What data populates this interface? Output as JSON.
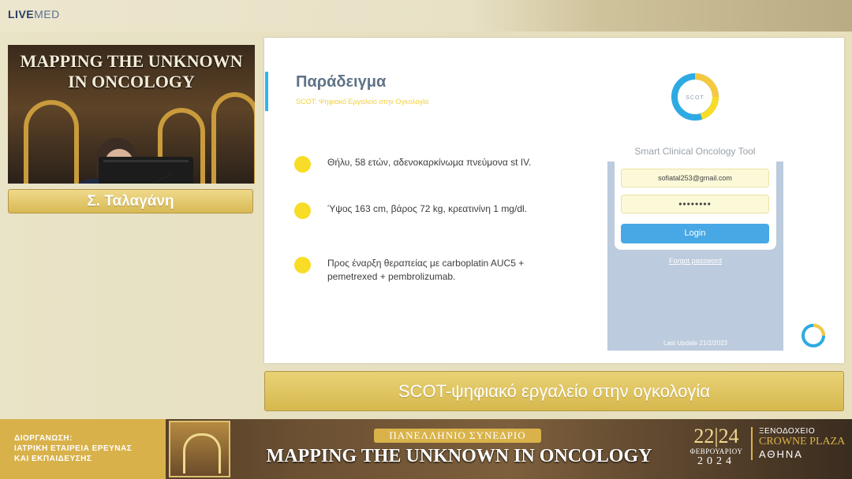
{
  "brand": {
    "live": "LIVE",
    "med": "MED"
  },
  "video": {
    "line1": "MAPPING THE UNKNOWN",
    "line2": "IN ONCOLOGY"
  },
  "speaker": {
    "name": "Σ. Ταλαγάνη"
  },
  "slide": {
    "title": "Παράδειγμα",
    "subtitle": "SCOT: Ψηφιακό Εργαλείο στην Ογκολογία",
    "bullets": [
      {
        "text": "Θήλυ, 58 ετών, αδενοκαρκίνωμα πνεύμονα st IV."
      },
      {
        "text": "Ύψος 163 cm, βάρος 72 kg, κρεατινίνη 1 mg/dl."
      },
      {
        "text": "Προς έναρξη θεραπείας με carboplatin AUC5 + pemetrexed + pembrolizumab."
      }
    ],
    "logo_text": "SCOT",
    "app_name": "Smart Clinical Oncology Tool",
    "email_value": "sofiatal253@gmail.com",
    "password_value": "••••••••",
    "login_label": "Login",
    "forgot_label": "Forgot password",
    "last_update": "Last Update 21/2/2023",
    "colors": {
      "accent": "#29b6f6",
      "bullet": "#f9dc25",
      "login": "#48a8e5"
    }
  },
  "caption": "SCOT-ψηφιακό εργαλείο στην ογκολογία",
  "footer": {
    "organizer_line1": "ΔΙΟΡΓΑΝΩΣΗ:",
    "organizer_line2": "ΙΑΤΡΙΚΗ ΕΤΑΙΡΕΙΑ ΕΡΕΥΝΑΣ",
    "organizer_line3": "ΚΑΙ ΕΚΠΑΙΔΕΥΣΗΣ",
    "congress": "ΠΑΝΕΛΛΗΝΙΟ ΣΥΝΕΔΡΙΟ",
    "event_title": "MAPPING THE UNKNOWN IN ONCOLOGY",
    "days": "22|24",
    "month": "ΦΕΒΡΟΥΑΡΙΟΥ",
    "year": "2024",
    "venue1": "ΞΕΝΟΔΟΧΕΙΟ",
    "venue2": "CROWNE PLAZA",
    "venue3": "ΑΘΗΝΑ"
  }
}
